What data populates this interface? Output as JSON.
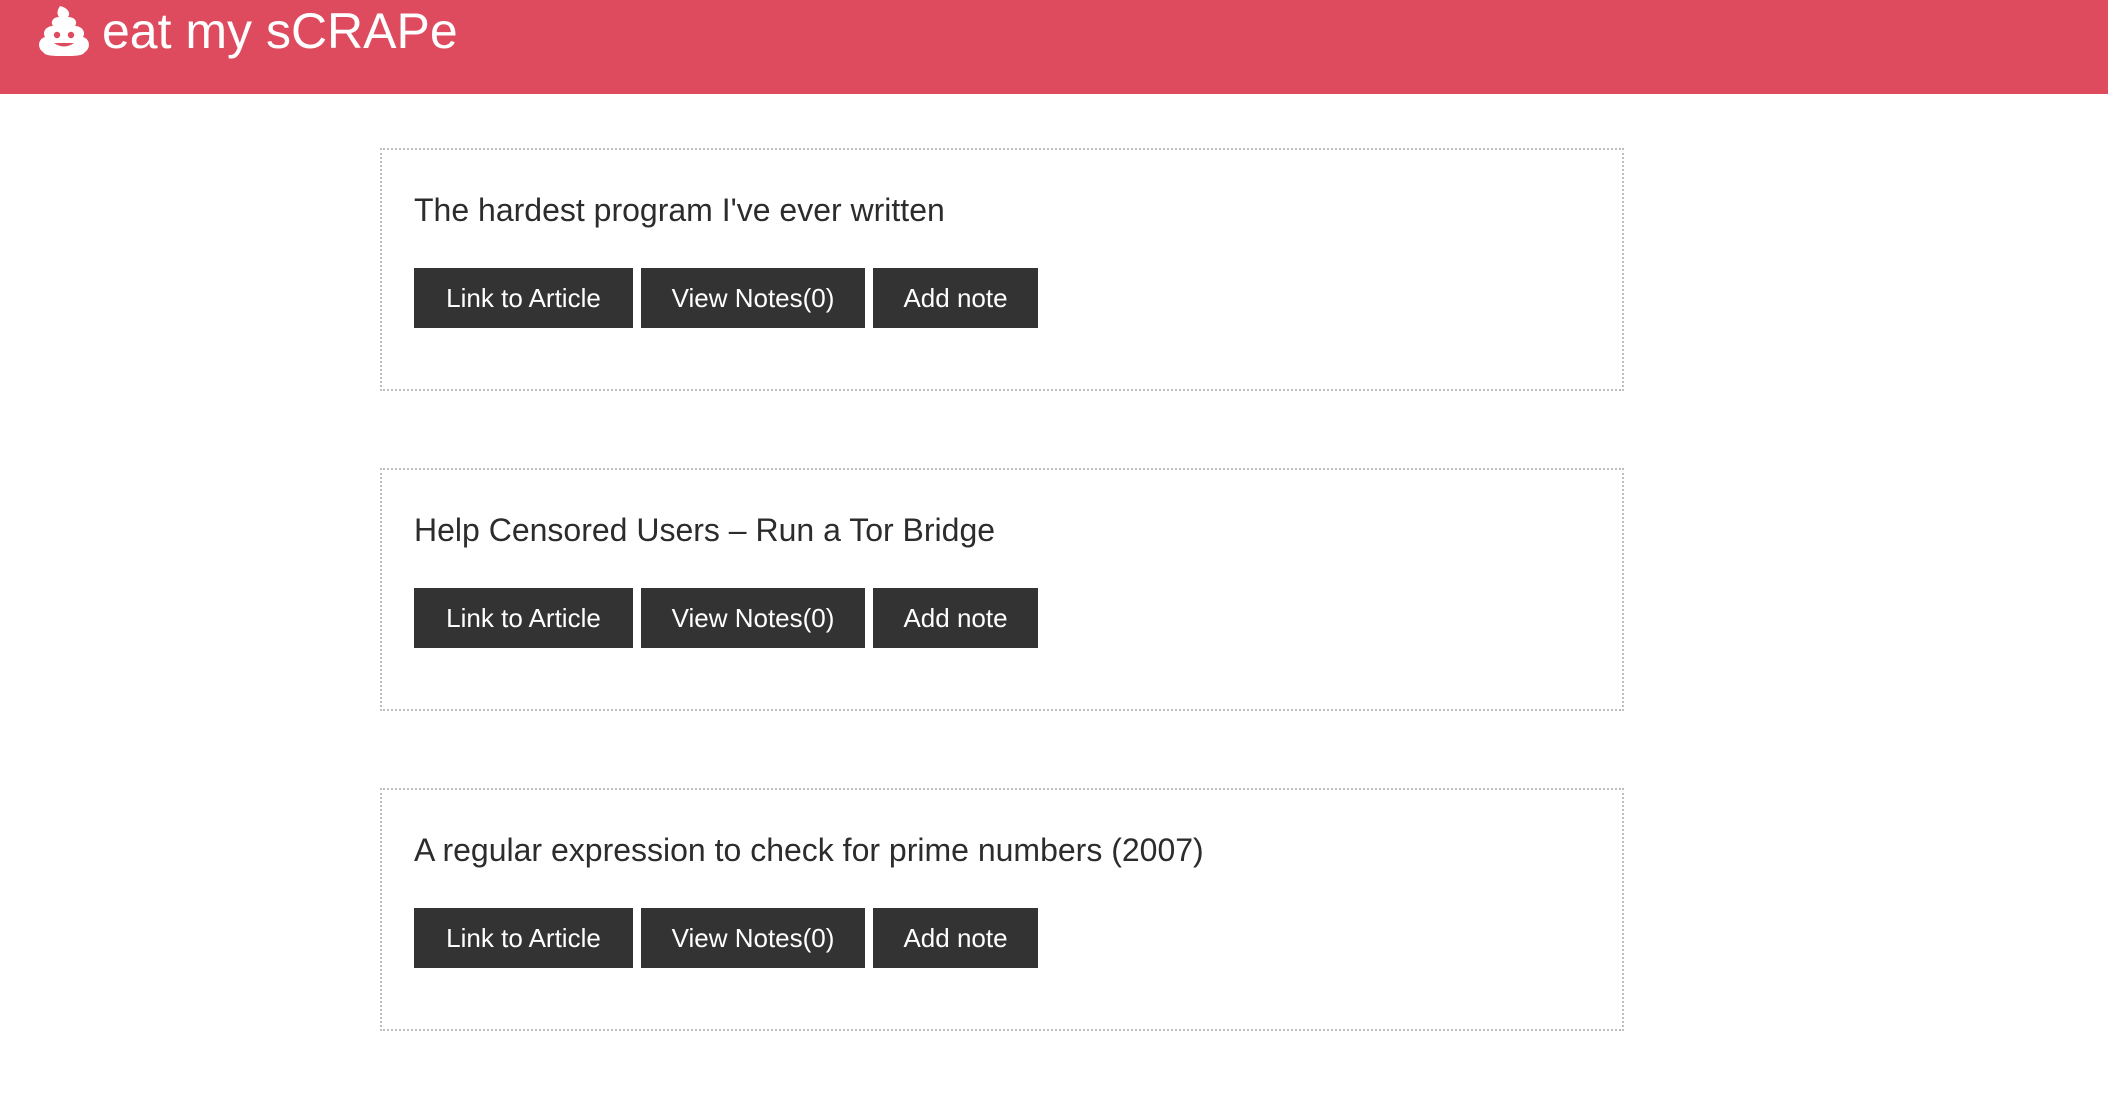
{
  "theme": {
    "accent": "#de4b5e",
    "button_bg": "#333333"
  },
  "header": {
    "brand_icon": "poop-icon",
    "title": "eat my sCRAPe"
  },
  "articles": [
    {
      "title": "The hardest program I've ever written",
      "link_label": "Link to Article",
      "notes_label": "View Notes(0)",
      "add_label": "Add note"
    },
    {
      "title": "Help Censored Users – Run a Tor Bridge",
      "link_label": "Link to Article",
      "notes_label": "View Notes(0)",
      "add_label": "Add note"
    },
    {
      "title": "A regular expression to check for prime numbers (2007)",
      "link_label": "Link to Article",
      "notes_label": "View Notes(0)",
      "add_label": "Add note"
    }
  ]
}
